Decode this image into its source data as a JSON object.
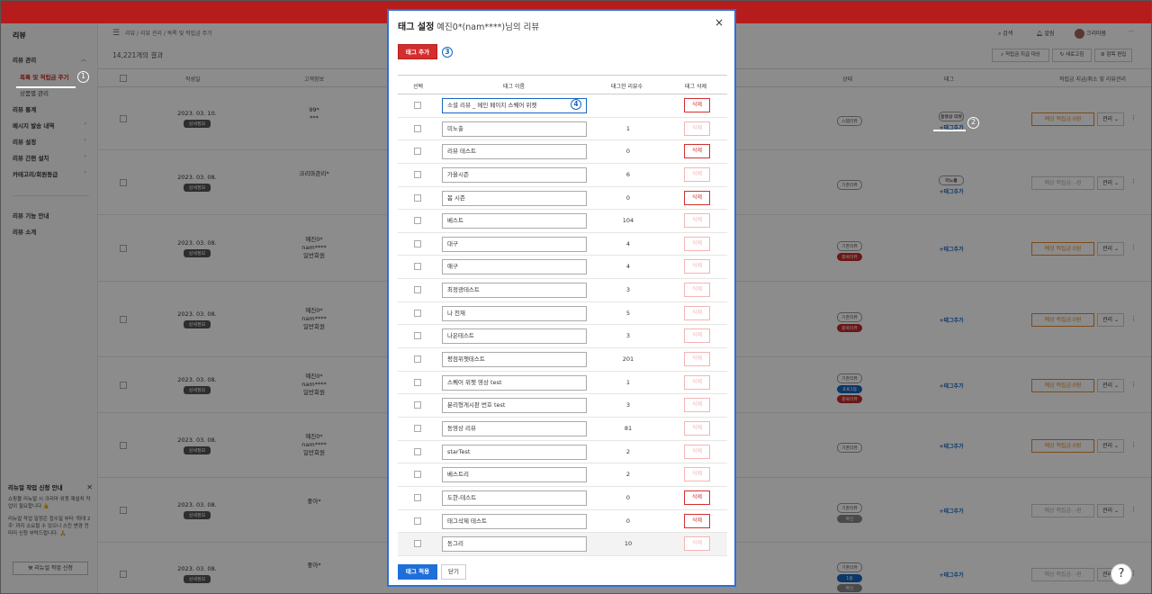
{
  "sidebar": {
    "title": "리뷰",
    "items": [
      {
        "label": "리뷰 관리"
      },
      {
        "label": "목록 및 적립금 주기"
      },
      {
        "label": "상품별 관리"
      },
      {
        "label": "리뷰 통계"
      },
      {
        "label": "메시지 발송 내역"
      },
      {
        "label": "리뷰 설정"
      },
      {
        "label": "리뷰 간편 설치"
      },
      {
        "label": "카테고리/회원등급"
      },
      {
        "label": "리뷰 기능 안내"
      },
      {
        "label": "리뷰 소개"
      }
    ],
    "promo": {
      "title": "리뉴얼 작업 신청 안내",
      "text": "쇼핑몰 리뉴얼 시 크리마 위젯 재설치 작업이 필요합니다 👍",
      "text2": "리뉴얼 작업 일정은 접수일 부터 '최대 2주' 까지 소요될 수 있으니 스킨 변경 전 미리 신청 부탁드립니다. 🙏",
      "button": "리뉴얼 작업 신청"
    }
  },
  "main": {
    "breadcrumb": "리뷰 / 리뷰 관리 / 목록 및 적립금 주기",
    "result_count": "14,221개의 결과",
    "header_right": {
      "search": "검색",
      "alarm": "알림",
      "user": "크리마봄",
      "more": "···"
    },
    "toolbar": {
      "filter": "적립금 지급 대상",
      "refresh": "새로고침",
      "edit_cols": "항목 편집"
    },
    "columns": {
      "date": "작성일",
      "customer": "고객정보",
      "status": "상태",
      "tag": "태그",
      "points": "적립금 지급/취소 및 리뷰관리"
    },
    "rows": [
      {
        "date": "2023. 03. 10.",
        "detail": "상세정보",
        "cust1": "99*",
        "cust2": "***",
        "cust3": "",
        "status": [
          "스텝리뷰"
        ],
        "tags": [
          "동영상 리뷰"
        ],
        "add_tag": "+태그추가",
        "points": "예상 적립금:0원",
        "manage": "관리",
        "dis": false
      },
      {
        "date": "2023. 03. 08.",
        "detail": "상세정보",
        "cust1": "크리마관리*",
        "cust2": "",
        "cust3": "",
        "status": [
          "기존리뷰"
        ],
        "tags": [
          "미노출"
        ],
        "add_tag": "+태그추가",
        "points": "예상 적립금: -원",
        "manage": "관리",
        "dis": true
      },
      {
        "date": "2023. 03. 08.",
        "detail": "상세정보",
        "cust1": "예진0*",
        "cust2": "nam****",
        "cust3": "일반회원",
        "status": [
          "기존리뷰",
          "중복리뷰"
        ],
        "tags": [],
        "add_tag": "+태그추가",
        "points": "예상 적립금:0원",
        "manage": "관리",
        "dis": false
      },
      {
        "date": "2023. 03. 08.",
        "detail": "상세정보",
        "cust1": "예진0*",
        "cust2": "nam****",
        "cust3": "일반회원",
        "status": [
          "기존리뷰",
          "중복리뷰"
        ],
        "tags": [],
        "add_tag": "+태그추가",
        "points": "예상 적립금:0원",
        "manage": "관리",
        "dis": false
      },
      {
        "date": "2023. 03. 08.",
        "detail": "상세정보",
        "cust1": "예진0*",
        "cust2": "nam****",
        "cust3": "일반회원",
        "status": [
          "기존리뷰",
          "포토1등",
          "중복리뷰"
        ],
        "tags": [],
        "add_tag": "+태그추가",
        "points": "예상 적립금:0원",
        "manage": "관리",
        "dis": false
      },
      {
        "date": "2023. 03. 08.",
        "detail": "상세정보",
        "cust1": "예진0*",
        "cust2": "nam****",
        "cust3": "일반회원",
        "status": [
          "기존리뷰"
        ],
        "tags": [],
        "add_tag": "+태그추가",
        "points": "예상 적립금:0원",
        "manage": "관리",
        "dis": false
      },
      {
        "date": "2023. 03. 08.",
        "detail": "상세정보",
        "cust1": "좋아*",
        "cust2": "",
        "cust3": "",
        "status": [
          "기존리뷰",
          "확인"
        ],
        "tags": [],
        "add_tag": "+태그추가",
        "points": "예상 적립금: -원",
        "manage": "관리",
        "dis": true
      },
      {
        "date": "2023. 03. 08.",
        "detail": "상세정보",
        "cust1": "좋아*",
        "cust2": "",
        "cust3": "",
        "status": [
          "기존리뷰",
          "1등",
          "확인"
        ],
        "tags": [],
        "add_tag": "+태그추가",
        "points": "예상 적립금: -원",
        "manage": "관리",
        "dis": true
      }
    ]
  },
  "modal": {
    "title": "태그 설정",
    "subtitle": "예진0*(nam****)님의 리뷰",
    "close": "×",
    "add_button": "태그 추가",
    "columns": {
      "select": "선택",
      "name": "태그 이름",
      "count": "태그한 리뷰수",
      "delete": "태그 삭제"
    },
    "delete_label": "삭제",
    "tags": [
      {
        "name": "소셜 리뷰 _ 메인 페이지 스퀘어 위젯",
        "count": "",
        "del": true
      },
      {
        "name": "미노출",
        "count": "1",
        "del": false
      },
      {
        "name": "리뷰 테스트",
        "count": "0",
        "del": true
      },
      {
        "name": "가을시즌",
        "count": "6",
        "del": false
      },
      {
        "name": "봄 시즌",
        "count": "0",
        "del": true
      },
      {
        "name": "베스트",
        "count": "104",
        "del": false
      },
      {
        "name": "대구",
        "count": "4",
        "del": false
      },
      {
        "name": "애구",
        "count": "4",
        "del": false
      },
      {
        "name": "최정광테스트",
        "count": "3",
        "del": false
      },
      {
        "name": "나 천재",
        "count": "5",
        "del": false
      },
      {
        "name": "나은테스트",
        "count": "3",
        "del": false
      },
      {
        "name": "평점위젯테스트",
        "count": "201",
        "del": false
      },
      {
        "name": "스퀘어 위젯 영상 test",
        "count": "1",
        "del": false
      },
      {
        "name": "분리형게시판 번호 test",
        "count": "3",
        "del": false
      },
      {
        "name": "동영상 리뷰",
        "count": "81",
        "del": false
      },
      {
        "name": "starTest",
        "count": "2",
        "del": false
      },
      {
        "name": "베스트리",
        "count": "2",
        "del": false
      },
      {
        "name": "도한-테스트",
        "count": "0",
        "del": true
      },
      {
        "name": "태그삭제 테스트",
        "count": "0",
        "del": true
      },
      {
        "name": "동그리",
        "count": "10",
        "del": false
      }
    ],
    "apply_button": "태그 적용",
    "close_button": "닫기"
  },
  "annotations": [
    "1",
    "2",
    "3",
    "4"
  ],
  "help": "?",
  "colors": {
    "brand_red": "#b71c1c",
    "delete_red": "#d32f2f",
    "apply_blue": "#1e6fd9",
    "modal_border": "#2f6fd6"
  }
}
